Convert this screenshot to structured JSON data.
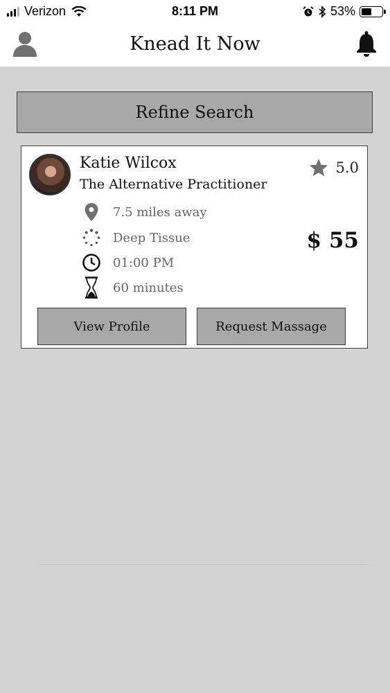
{
  "status_bar": {
    "carrier": "Verizon",
    "time": "8:11 PM",
    "battery": "53%",
    "battery_level": 0.53,
    "signal_bars": 3,
    "icons": [
      "signal-icon",
      "wifi-icon",
      "alarm-icon",
      "bluetooth-icon",
      "battery-icon"
    ]
  },
  "header": {
    "title": "Knead It Now",
    "left_icon": "profile-icon",
    "right_icon": "bell-icon"
  },
  "refine_button": {
    "label": "Refine Search"
  },
  "result_card": {
    "name": "Katie Wilcox",
    "subtitle": "The Alternative Practitioner",
    "rating": "5.0",
    "price": "$ 55",
    "details": [
      {
        "icon": "location-pin-icon",
        "text": "7.5 miles away"
      },
      {
        "icon": "spinner-icon",
        "text": "Deep Tissue"
      },
      {
        "icon": "clock-icon",
        "text": "01:00 PM"
      },
      {
        "icon": "hourglass-icon",
        "text": "60 minutes"
      }
    ],
    "view_profile_label": "View Profile",
    "request_label": "Request Massage"
  },
  "colors": {
    "background": "#d4d3d4",
    "button_fill": "#a9a8a9",
    "icon_gray": "#707070",
    "card_background": "#ffffff"
  }
}
